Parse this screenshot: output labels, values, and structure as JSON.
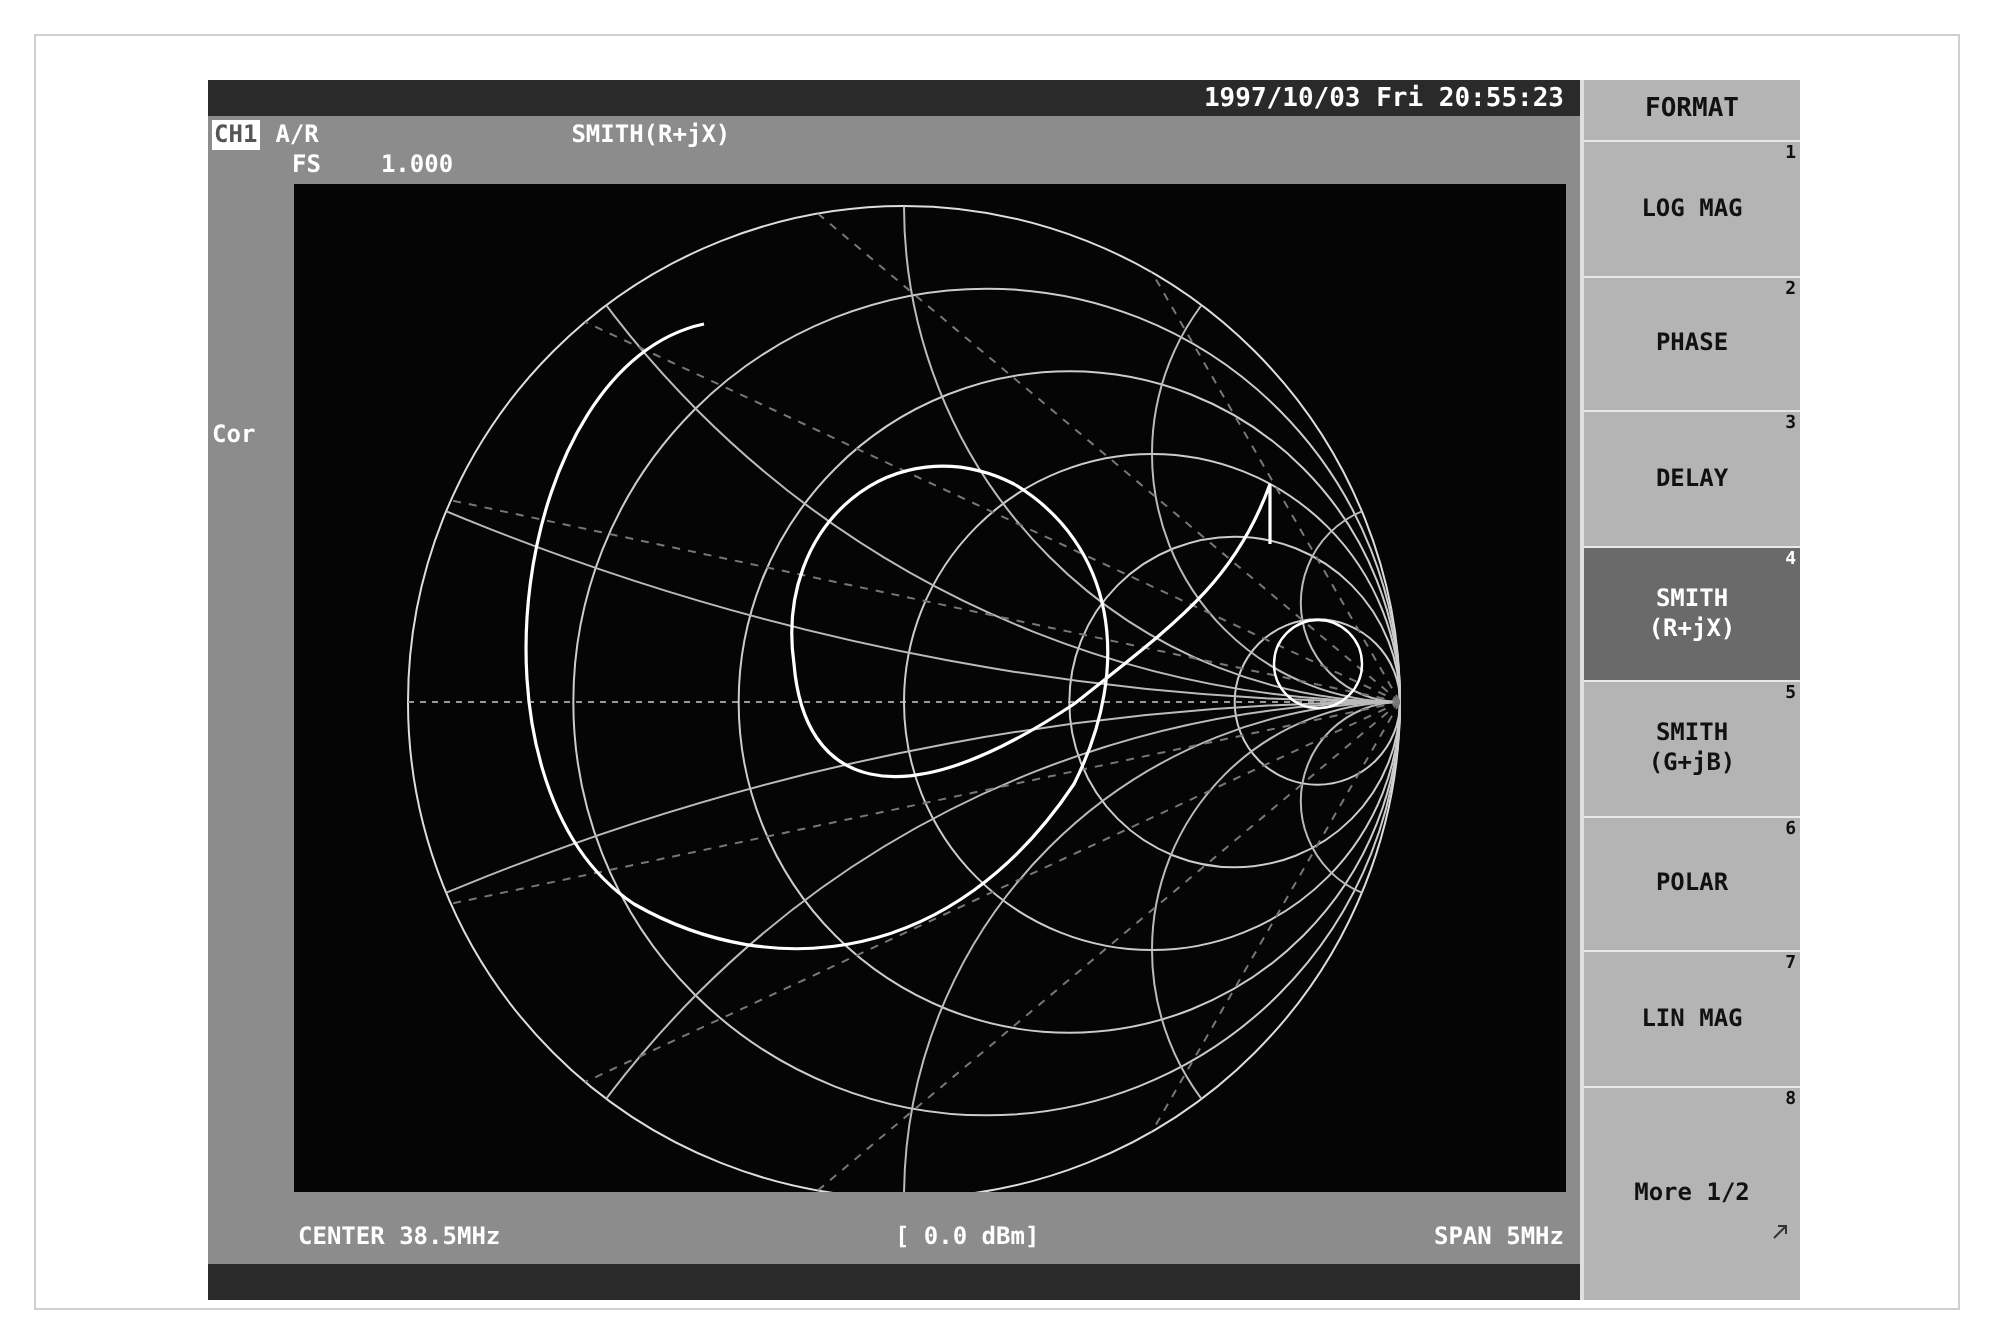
{
  "header": {
    "channel": "CH1",
    "parameter": "A/R",
    "format": "SMITH(R+jX)",
    "scale_label": "FS",
    "scale_value": "1.000",
    "datetime": "1997/10/03 Fri 20:55:23"
  },
  "marker_label": "Cor",
  "footer": {
    "center": "CENTER 38.5MHz",
    "power": "[ 0.0 dBm]",
    "span": "SPAN 5MHz"
  },
  "softkeys": {
    "title": "FORMAT",
    "items": [
      {
        "lines": [
          "LOG MAG"
        ],
        "number": "1",
        "selected": false
      },
      {
        "lines": [
          "PHASE"
        ],
        "number": "2",
        "selected": false
      },
      {
        "lines": [
          "DELAY"
        ],
        "number": "3",
        "selected": false
      },
      {
        "lines": [
          "SMITH",
          "(R+jX)"
        ],
        "number": "4",
        "selected": true
      },
      {
        "lines": [
          "SMITH",
          "(G+jB)"
        ],
        "number": "5",
        "selected": false
      },
      {
        "lines": [
          "POLAR"
        ],
        "number": "6",
        "selected": false
      },
      {
        "lines": [
          "LIN MAG"
        ],
        "number": "7",
        "selected": false
      },
      {
        "lines": [
          "More 1/2"
        ],
        "number": "8",
        "selected": false,
        "kind": "more"
      }
    ]
  }
}
